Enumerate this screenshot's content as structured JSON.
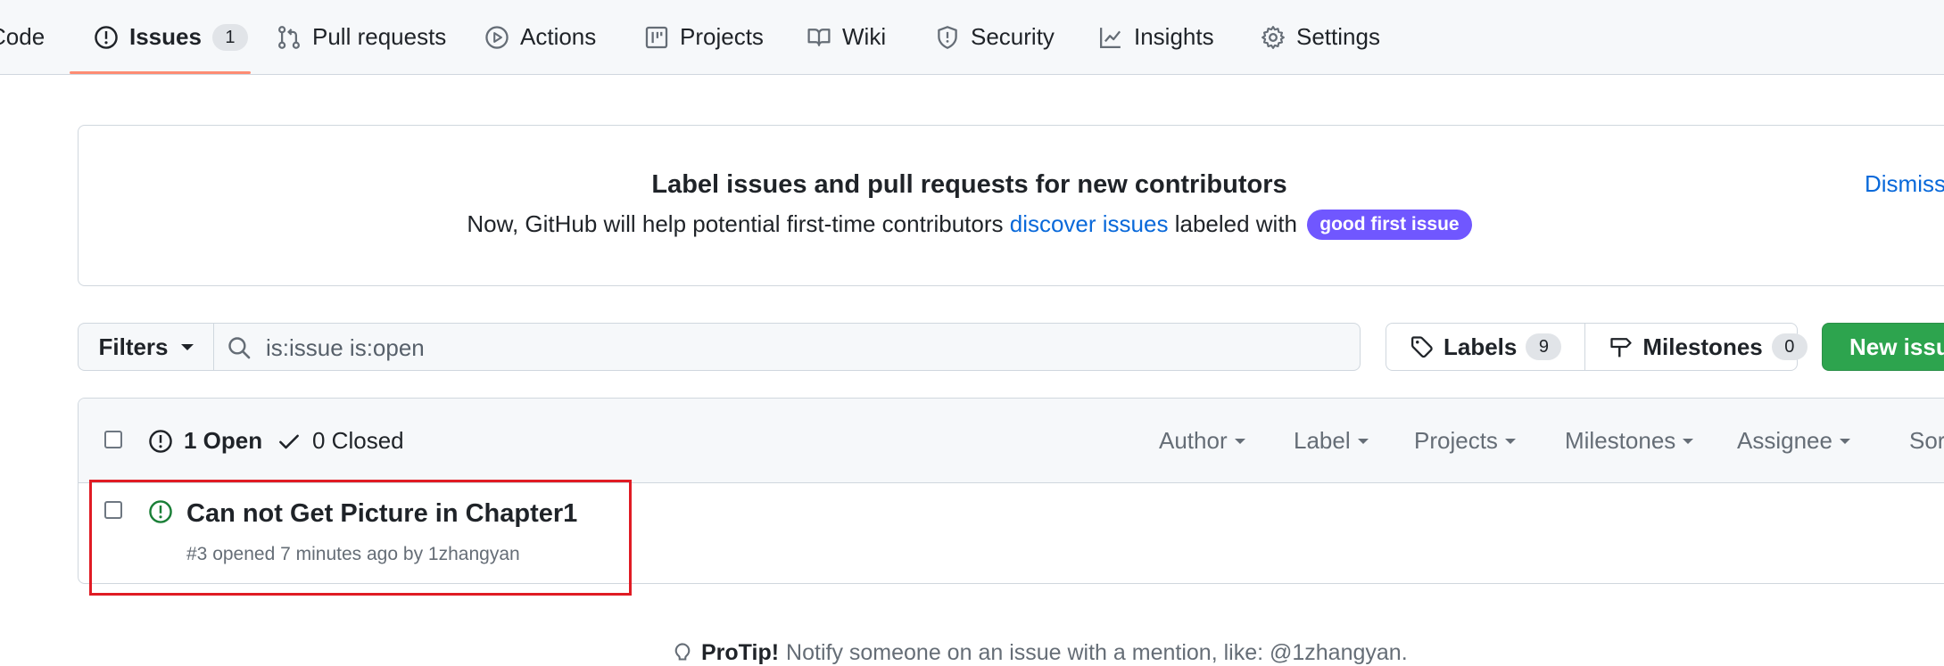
{
  "repo_nav": {
    "items": [
      {
        "label": "Code",
        "icon": "code-icon"
      },
      {
        "label": "Issues",
        "icon": "issue-opened-icon",
        "count": "1",
        "selected": true
      },
      {
        "label": "Pull requests",
        "icon": "git-pull-request-icon"
      },
      {
        "label": "Actions",
        "icon": "play-icon"
      },
      {
        "label": "Projects",
        "icon": "table-icon"
      },
      {
        "label": "Wiki",
        "icon": "book-icon"
      },
      {
        "label": "Security",
        "icon": "shield-icon"
      },
      {
        "label": "Insights",
        "icon": "graph-icon"
      },
      {
        "label": "Settings",
        "icon": "gear-icon"
      }
    ],
    "underline_color": "#fd8c73"
  },
  "banner": {
    "title": "Label issues and pull requests for new contributors",
    "text_before": "Now, GitHub will help potential first-time contributors",
    "link": "discover issues",
    "text_after": "labeled with",
    "label": "good first issue",
    "label_color": "#7057ff",
    "dismiss": "Dismiss"
  },
  "filter_bar": {
    "filters_label": "Filters",
    "search_value": "is:issue is:open",
    "labels_label": "Labels",
    "labels_count": "9",
    "milestones_label": "Milestones",
    "milestones_count": "0",
    "new_issue_label": "New issue",
    "new_issue_color": "#2da44e"
  },
  "issues_header": {
    "open_label": "1 Open",
    "closed_label": "0 Closed",
    "sort_menus": [
      "Author",
      "Label",
      "Projects",
      "Milestones",
      "Assignee",
      "Sort"
    ]
  },
  "issues": [
    {
      "title": "Can not Get Picture in Chapter1",
      "number": "#3",
      "opened_text": "opened",
      "time": "7 minutes ago",
      "by_text": "by",
      "author": "1zhangyan",
      "state_color": "#1a7f37"
    }
  ],
  "protip": {
    "label": "ProTip!",
    "text": "Notify someone on an issue with a mention, like: @1zhangyan."
  }
}
